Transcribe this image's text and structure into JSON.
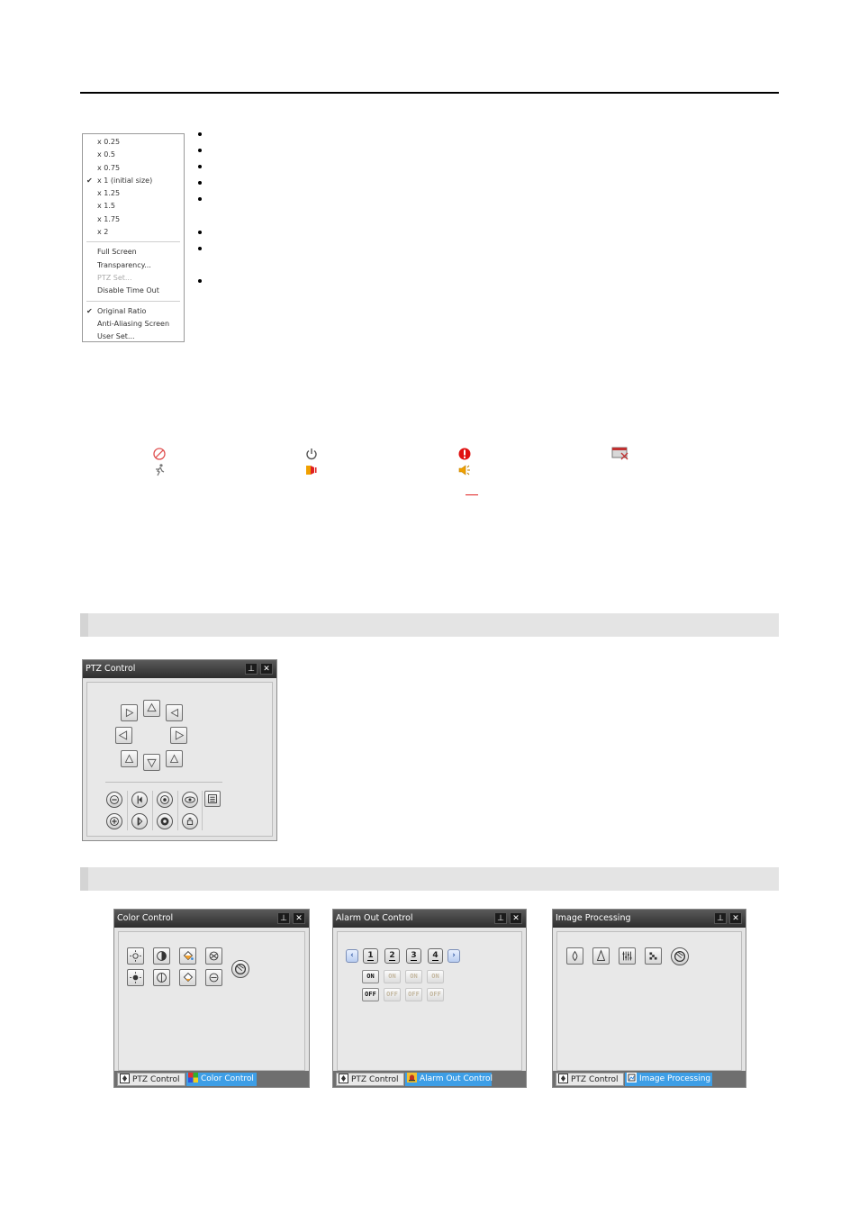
{
  "menu": {
    "zoom_items": [
      {
        "label": "x 0.25",
        "checked": false
      },
      {
        "label": "x 0.5",
        "checked": false
      },
      {
        "label": "x 0.75",
        "checked": false
      },
      {
        "label": "x 1 (initial size)",
        "checked": true
      },
      {
        "label": "x 1.25",
        "checked": false
      },
      {
        "label": "x 1.5",
        "checked": false
      },
      {
        "label": "x 1.75",
        "checked": false
      },
      {
        "label": "x 2",
        "checked": false
      }
    ],
    "view_items": [
      {
        "label": "Full Screen",
        "disabled": false
      },
      {
        "label": "Transparency...",
        "disabled": false
      },
      {
        "label": "PTZ Set...",
        "disabled": true
      },
      {
        "label": "Disable Time Out",
        "disabled": false
      }
    ],
    "option_items": [
      {
        "label": "Original Ratio",
        "checked": true
      },
      {
        "label": "Anti-Aliasing Screen",
        "checked": false
      },
      {
        "label": "User Set...",
        "checked": false
      }
    ],
    "check_glyph": "✔"
  },
  "status_icons": [
    {
      "name": "no-connection-icon",
      "color": "#e05050"
    },
    {
      "name": "power-icon",
      "color": "#555555"
    },
    {
      "name": "alert-icon",
      "color": "#e01010"
    },
    {
      "name": "video-loss-icon",
      "color": "#c03030"
    },
    {
      "name": "motion-icon",
      "color": "#777777"
    },
    {
      "name": "alarm-in-icon",
      "color": "#f0a000"
    },
    {
      "name": "audio-icon",
      "color": "#f0a000"
    }
  ],
  "ptz_panel": {
    "title": "PTZ Control",
    "pin": "⊥",
    "close": "✕"
  },
  "color_panel": {
    "title": "Color Control",
    "pin": "⊥",
    "close": "✕",
    "tabs": [
      {
        "label": "PTZ Control"
      },
      {
        "label": "Color Control"
      }
    ]
  },
  "alarm_panel": {
    "title": "Alarm Out Control",
    "pin": "⊥",
    "close": "✕",
    "prev": "‹",
    "next": "›",
    "channels": [
      "1",
      "2",
      "3",
      "4"
    ],
    "on_labels": [
      "ON",
      "ON",
      "ON",
      "ON"
    ],
    "off_labels": [
      "OFF",
      "OFF",
      "OFF",
      "OFF"
    ],
    "tabs": [
      {
        "label": "PTZ Control"
      },
      {
        "label": "Alarm Out Control"
      }
    ]
  },
  "image_panel": {
    "title": "Image Processing",
    "pin": "⊥",
    "close": "✕",
    "tabs": [
      {
        "label": "PTZ Control"
      },
      {
        "label": "Image Processing"
      }
    ]
  },
  "colors": {
    "title_bar": "#3a3a3a",
    "active_tab": "#3d9ee6",
    "section_bar": "#e4e4e4"
  }
}
